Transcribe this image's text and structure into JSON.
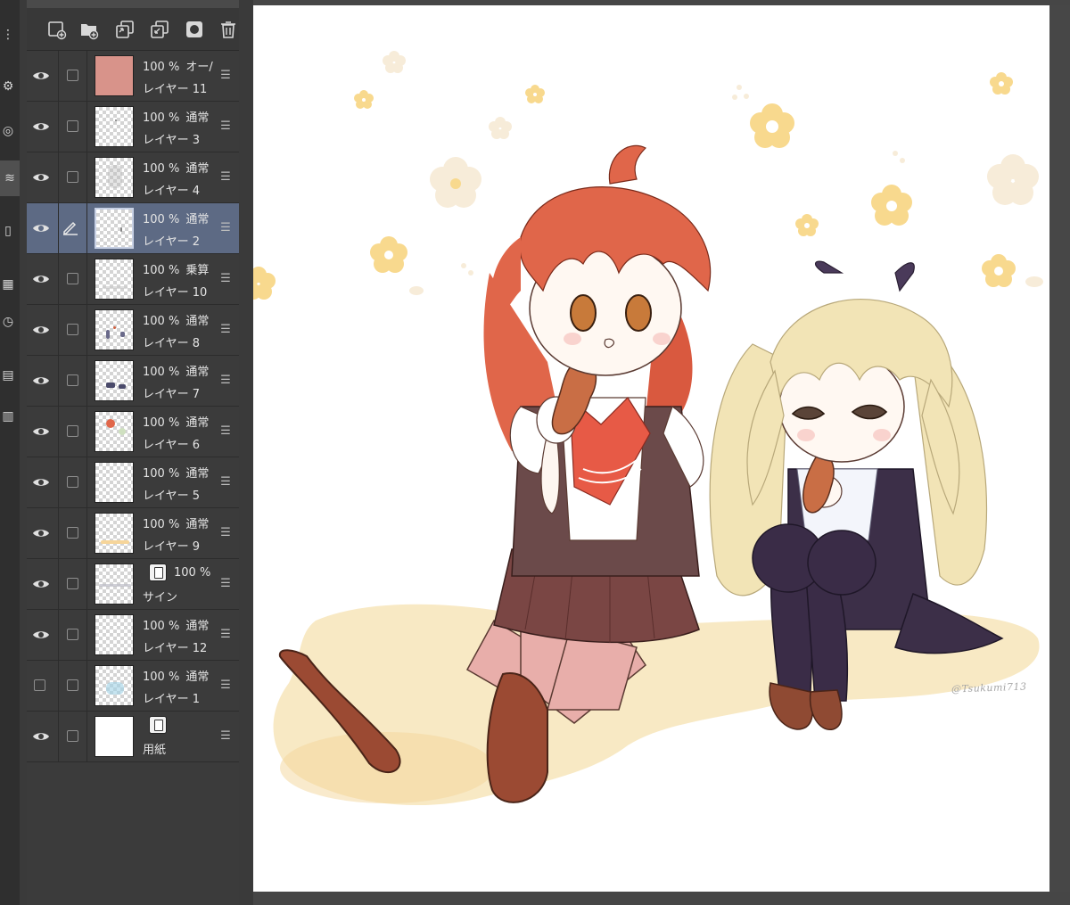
{
  "colors": {
    "panel_bg": "#3b3b3b",
    "selected_row": "#5d6a84",
    "canvas_bg": "#ffffff",
    "flower": "#f8d98e",
    "ground": "#f6e1b0",
    "red_hair": "#e0664a",
    "blonde_hair": "#f2e4b6"
  },
  "toolbar": {
    "buttons": [
      "new-raster-layer-icon",
      "new-folder-icon",
      "copy-layer-icon",
      "merge-down-icon",
      "layer-mask-icon",
      "delete-layer-icon"
    ]
  },
  "layers": [
    {
      "opacity": "100 %",
      "blend": "オー/",
      "name": "レイヤー 11",
      "visible": true,
      "selected": false
    },
    {
      "opacity": "100 %",
      "blend": "通常",
      "name": "レイヤー 3",
      "visible": true,
      "selected": false
    },
    {
      "opacity": "100 %",
      "blend": "通常",
      "name": "レイヤー 4",
      "visible": true,
      "selected": false
    },
    {
      "opacity": "100 %",
      "blend": "通常",
      "name": "レイヤー 2",
      "visible": true,
      "selected": true
    },
    {
      "opacity": "100 %",
      "blend": "乗算",
      "name": "レイヤー 10",
      "visible": true,
      "selected": false
    },
    {
      "opacity": "100 %",
      "blend": "通常",
      "name": "レイヤー 8",
      "visible": true,
      "selected": false
    },
    {
      "opacity": "100 %",
      "blend": "通常",
      "name": "レイヤー 7",
      "visible": true,
      "selected": false
    },
    {
      "opacity": "100 %",
      "blend": "通常",
      "name": "レイヤー 6",
      "visible": true,
      "selected": false
    },
    {
      "opacity": "100 %",
      "blend": "通常",
      "name": "レイヤー 5",
      "visible": true,
      "selected": false
    },
    {
      "opacity": "100 %",
      "blend": "通常",
      "name": "レイヤー 9",
      "visible": true,
      "selected": false
    },
    {
      "opacity": "100 %",
      "blend": "",
      "name": "サイン",
      "visible": true,
      "selected": false
    },
    {
      "opacity": "100 %",
      "blend": "通常",
      "name": "レイヤー 12",
      "visible": true,
      "selected": false
    },
    {
      "opacity": "100 %",
      "blend": "通常",
      "name": "レイヤー 1",
      "visible": false,
      "selected": false
    },
    {
      "opacity": "",
      "blend": "",
      "name": "用紙",
      "visible": true,
      "selected": false
    }
  ],
  "canvas": {
    "signature": "@Tsukumi713"
  }
}
